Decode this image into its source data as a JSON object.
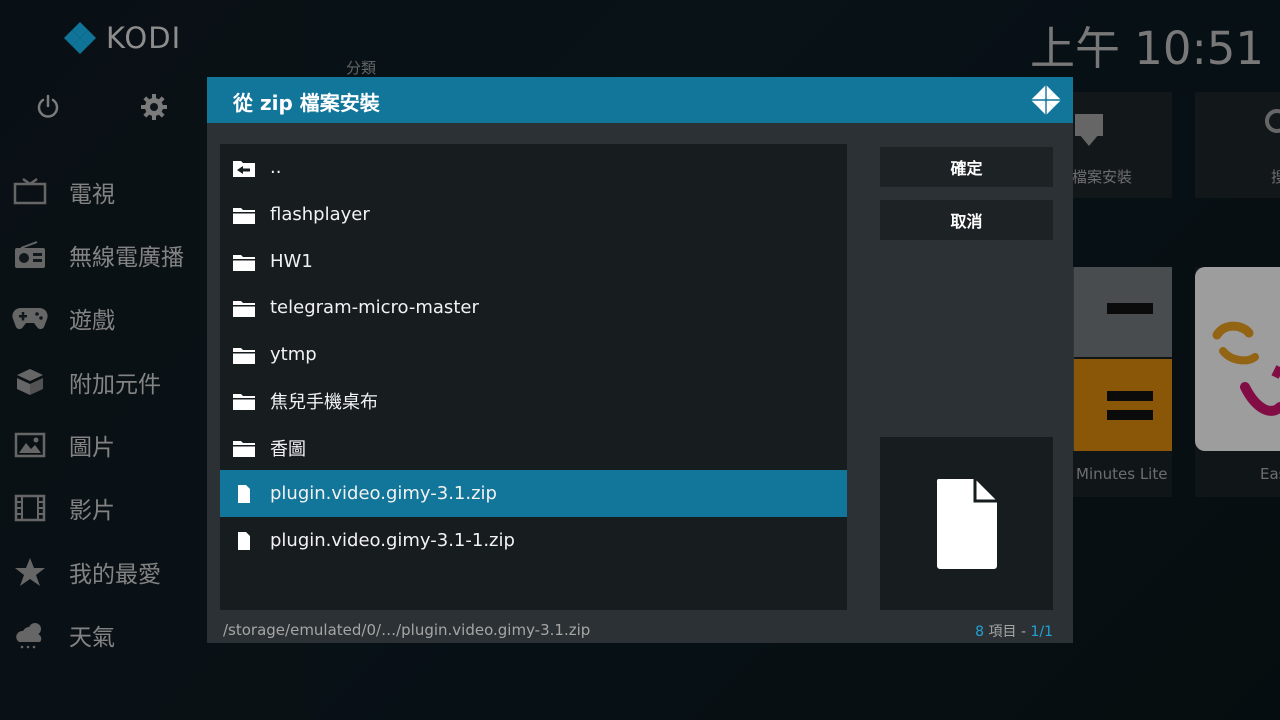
{
  "app": {
    "logo_text": "KODI",
    "clock": "上午 10:51",
    "category_label": "分類",
    "accent_color": "#12759a"
  },
  "sidebar": {
    "top_icons": [
      "power-icon",
      "gear-icon"
    ],
    "items": [
      {
        "label": "電視",
        "icon": "tv-icon"
      },
      {
        "label": "無線電廣播",
        "icon": "radio-icon"
      },
      {
        "label": "遊戲",
        "icon": "gamepad-icon"
      },
      {
        "label": "附加元件",
        "icon": "addon-box-icon"
      },
      {
        "label": "圖片",
        "icon": "picture-icon"
      },
      {
        "label": "影片",
        "icon": "film-icon"
      },
      {
        "label": "我的最愛",
        "icon": "star-icon"
      },
      {
        "label": "天氣",
        "icon": "weather-icon"
      }
    ]
  },
  "background": {
    "tiles": [
      {
        "label": "檔案安裝"
      },
      {
        "label": "搜"
      },
      {
        "label": "Minutes Lite"
      },
      {
        "label": "Easy"
      }
    ]
  },
  "dialog": {
    "title": "從 zip 檔案安裝",
    "confirm_label": "確定",
    "cancel_label": "取消",
    "files": [
      {
        "name": "..",
        "type": "parent",
        "icon": "folder-back-icon"
      },
      {
        "name": "flashplayer",
        "type": "folder",
        "icon": "folder-icon"
      },
      {
        "name": "HW1",
        "type": "folder",
        "icon": "folder-icon"
      },
      {
        "name": "telegram-micro-master",
        "type": "folder",
        "icon": "folder-icon"
      },
      {
        "name": "ytmp",
        "type": "folder",
        "icon": "folder-icon"
      },
      {
        "name": "焦兒手機桌布",
        "type": "folder",
        "icon": "folder-icon"
      },
      {
        "name": "香圖",
        "type": "folder",
        "icon": "folder-icon"
      },
      {
        "name": "plugin.video.gimy-3.1.zip",
        "type": "file",
        "icon": "file-icon",
        "selected": true
      },
      {
        "name": "plugin.video.gimy-3.1-1.zip",
        "type": "file",
        "icon": "file-icon"
      }
    ],
    "path": "/storage/emulated/0/…/plugin.video.gimy-3.1.zip",
    "item_count": "8",
    "item_count_label": "項目",
    "separator": "-",
    "page": "1/1",
    "preview_icon": "file-icon"
  }
}
